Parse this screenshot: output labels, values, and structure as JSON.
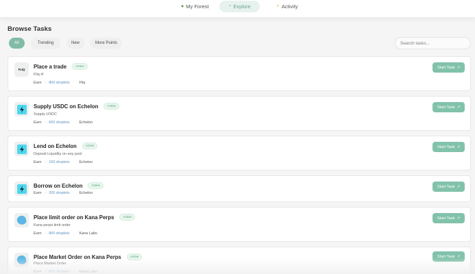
{
  "nav": {
    "forest_label": "My Forest",
    "explore_label": "Explore",
    "activity_label": "Activity"
  },
  "page": {
    "title": "Browse Tasks"
  },
  "filters": {
    "all": "All",
    "trending": "Trending",
    "new": "New",
    "more_points": "More Points"
  },
  "search": {
    "placeholder": "Search tasks..."
  },
  "tasks": [
    {
      "title": "Place a trade",
      "status": "Active",
      "description": "Fliq it!",
      "earn_label": "Earn",
      "reward": "800 droplets",
      "partner": "Fliq",
      "logo": "fliq-logo",
      "logo_text": "FLIQ",
      "button": "Start Task"
    },
    {
      "title": "Supply USDC on Echelon",
      "status": "Active",
      "description": "Supply USDC",
      "earn_label": "Earn",
      "reward": "600 droplets",
      "partner": "Echelon",
      "logo": "echelon-logo",
      "button": "Start Task"
    },
    {
      "title": "Lend on Echelon",
      "status": "Active",
      "description": "Deposit Liquidity on any pool",
      "earn_label": "Earn",
      "reward": "100 droplets",
      "partner": "Echelon",
      "logo": "echelon-logo",
      "button": "Start Task"
    },
    {
      "title": "Borrow on Echelon",
      "status": "Active",
      "description": "",
      "earn_label": "Earn",
      "reward": "200 droplets",
      "partner": "Echelon",
      "logo": "echelon-logo",
      "button": "Start Task"
    },
    {
      "title": "Place limit order on Kana Perps",
      "status": "Active",
      "description": "Kana perps limit order",
      "earn_label": "Earn",
      "reward": "800 droplets",
      "partner": "Kana Labs",
      "logo": "kana-logo",
      "button": "Start Task"
    },
    {
      "title": "Place Market Order on Kana Perps",
      "status": "Active",
      "description": "Place Market Order",
      "earn_label": "Earn",
      "reward": "800 droplets",
      "partner": "Kana Labs",
      "logo": "kana-logo",
      "button": "Start Task"
    }
  ],
  "colors": {
    "accent": "#82c2ab",
    "accent_chip": "#80bca6",
    "badge_text": "#52a377",
    "reward_text": "#5c94c4",
    "echelon": "#4fd7ee",
    "kana": "#5cb6e6"
  }
}
